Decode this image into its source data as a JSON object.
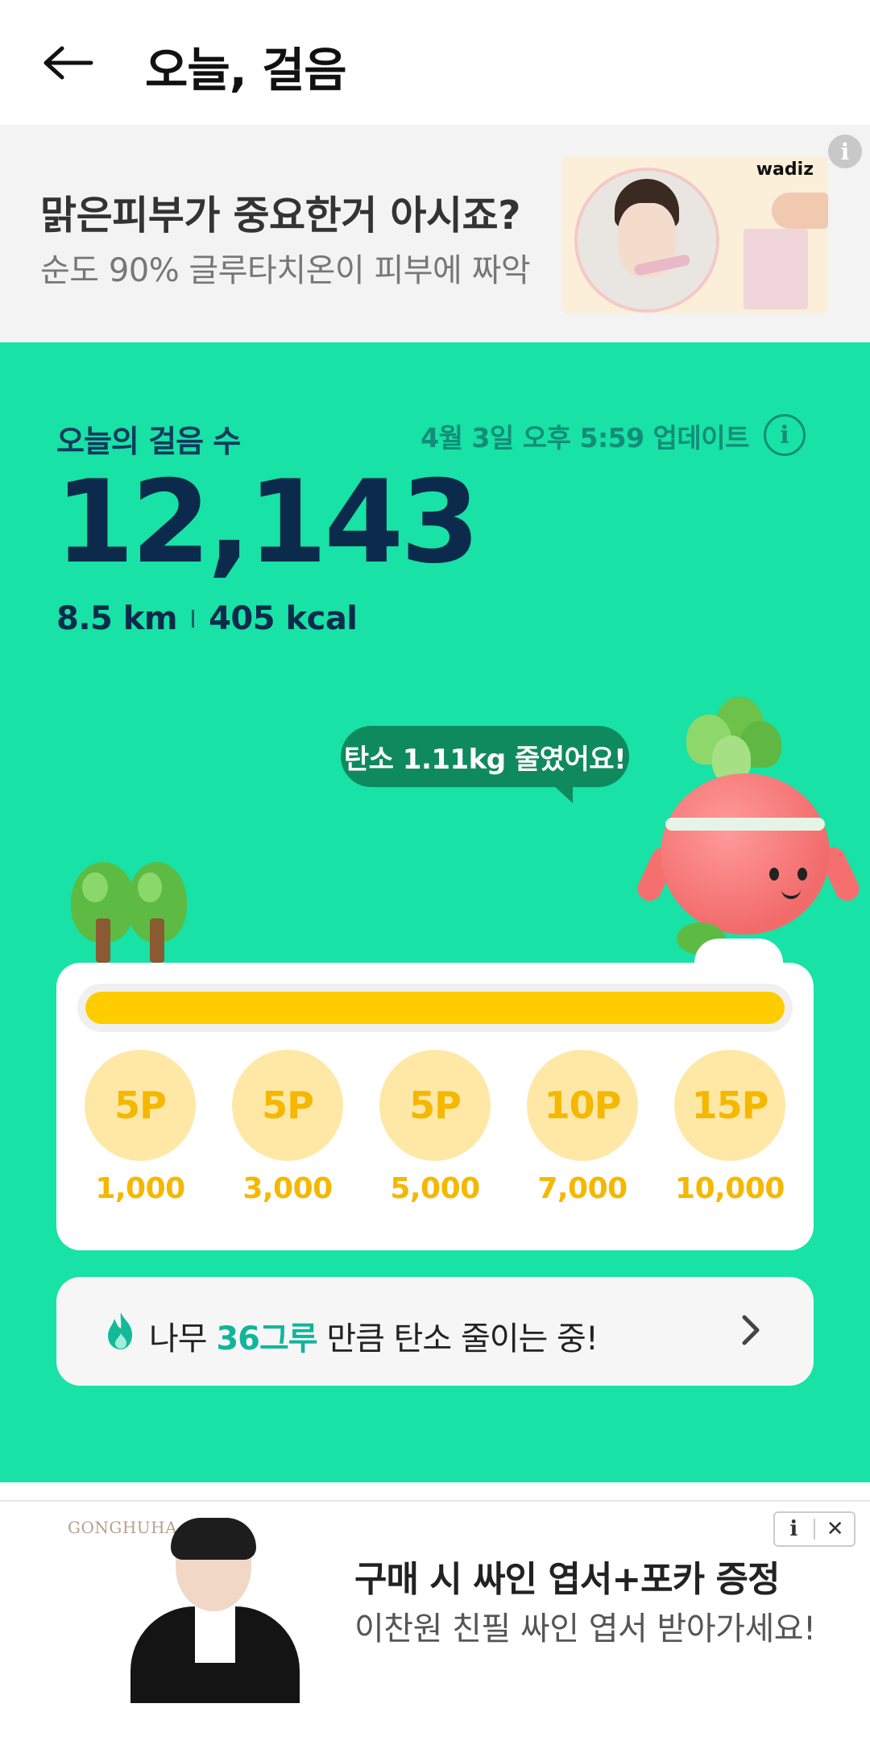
{
  "header": {
    "title": "오늘, 걸음",
    "back_icon": "arrow-left-icon"
  },
  "ad_top": {
    "title": "맑은피부가 중요한거 아시죠?",
    "subtitle": "순도 90% 글루타치온이 피부에 짜악",
    "brand": "wadiz",
    "info_icon": "i"
  },
  "steps": {
    "label": "오늘의 걸음 수",
    "update": "4월 3일 오후 5:59 업데이트",
    "info_icon": "i",
    "count": "12,143",
    "distance": "8.5 km",
    "calories": "405 kcal"
  },
  "bubble": {
    "text": "탄소 1.11kg 줄였어요!"
  },
  "rewards": {
    "progress": 1.0,
    "accent_color": "#ffcc00",
    "items": [
      {
        "points": "5P",
        "steps": "1,000"
      },
      {
        "points": "5P",
        "steps": "3,000"
      },
      {
        "points": "5P",
        "steps": "5,000"
      },
      {
        "points": "10P",
        "steps": "7,000"
      },
      {
        "points": "15P",
        "steps": "10,000"
      }
    ]
  },
  "carbon": {
    "prefix": "나무",
    "highlight": "36그루",
    "suffix": "만큼 탄소 줄이는 중!"
  },
  "ad_bottom": {
    "brand": "GONGHUHA",
    "title": "구매 시 싸인 엽서+포카 증정",
    "subtitle": "이찬원 친필 싸인 엽서 받아가세요!",
    "info_label": "i",
    "close_label": "✕"
  },
  "colors": {
    "green_bg": "#18e2a5",
    "navy": "#0c2b4c",
    "teal_text": "#10b59a"
  }
}
